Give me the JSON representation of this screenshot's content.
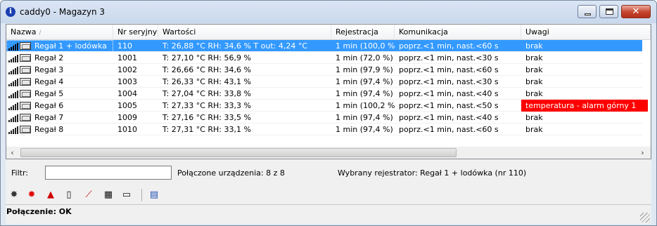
{
  "window": {
    "title": "caddy0 - Magazyn 3",
    "icon": "info-icon"
  },
  "table": {
    "columns": [
      "Nazwa",
      "Nr seryjny",
      "Wartości",
      "Rejestracja",
      "Komunikacja",
      "Uwagi"
    ],
    "rows": [
      {
        "name": "Regał 1 + lodówka",
        "serial": "110",
        "values": "T:  26,88 °C   RH:  34,6 %   T out:  4,24 °C",
        "registration": "1 min (100,0 %)",
        "communication": "poprz.<1 min, nast.<60 s",
        "notes": "brak",
        "selected": true,
        "alarm": false
      },
      {
        "name": "Regał 2",
        "serial": "1001",
        "values": "T:  27,10 °C   RH:  56,9 %",
        "registration": "1 min (72,0 %)",
        "communication": "poprz.<1 min, nast.<30 s",
        "notes": "brak",
        "selected": false,
        "alarm": false
      },
      {
        "name": "Regał 3",
        "serial": "1002",
        "values": "T:  26,66 °C   RH:  34,6 %",
        "registration": "1 min (97,9 %)",
        "communication": "poprz.<1 min, nast.<60 s",
        "notes": "brak",
        "selected": false,
        "alarm": false
      },
      {
        "name": "Regał 4",
        "serial": "1003",
        "values": "T:  26,33 °C   RH:  43,1 %",
        "registration": "1 min (97,4 %)",
        "communication": "poprz.<1 min, nast.<30 s",
        "notes": "brak",
        "selected": false,
        "alarm": false
      },
      {
        "name": "Regał 5",
        "serial": "1004",
        "values": "T:  27,04 °C   RH:  33,8 %",
        "registration": "1 min (97,4 %)",
        "communication": "poprz.<1 min, nast.<40 s",
        "notes": "brak",
        "selected": false,
        "alarm": false
      },
      {
        "name": "Regał 6",
        "serial": "1005",
        "values": "T:  27,33 °C   RH:  33,3 %",
        "registration": "1 min (100,2 %)",
        "communication": "poprz.<1 min, nast.<50 s",
        "notes": "temperatura - alarm górny 1",
        "selected": false,
        "alarm": true
      },
      {
        "name": "Regał 7",
        "serial": "1009",
        "values": "T:  27,16 °C   RH:  33,5 %",
        "registration": "1 min (97,4 %)",
        "communication": "poprz.<1 min, nast.<40 s",
        "notes": "brak",
        "selected": false,
        "alarm": false
      },
      {
        "name": "Regał 8",
        "serial": "1010",
        "values": "T:  27,31 °C   RH:  33,1 %",
        "registration": "1 min (97,4 %)",
        "communication": "poprz.<1 min, nast.<60 s",
        "notes": "brak",
        "selected": false,
        "alarm": false
      }
    ]
  },
  "filter": {
    "label": "Filtr:",
    "value": ""
  },
  "connected_label": "Połączone urządzenia: 8 z 8",
  "selected_label": "Wybrany rejestrator: Regał 1 + lodówka (nr 110)",
  "toolbar": [
    {
      "name": "settings-gear-icon",
      "glyph": "✸",
      "color": "#333333"
    },
    {
      "name": "alarm-sun-icon",
      "glyph": "✹",
      "color": "#e00000"
    },
    {
      "name": "siren-icon",
      "glyph": "▲",
      "color": "#d00000"
    },
    {
      "name": "book-icon",
      "glyph": "▯",
      "color": "#111111"
    },
    {
      "name": "chart-icon",
      "glyph": "⟋",
      "color": "#c00000"
    },
    {
      "name": "table-icon",
      "glyph": "▦",
      "color": "#111111"
    },
    {
      "name": "open-book-icon",
      "glyph": "▭",
      "color": "#111111"
    },
    {
      "name": "device-icon",
      "glyph": "▤",
      "color": "#1f4fb5"
    }
  ],
  "status": "Połączenie: OK",
  "colors": {
    "selection": "#3399ff",
    "alarm": "#ff0000",
    "close": "#c4432c"
  }
}
